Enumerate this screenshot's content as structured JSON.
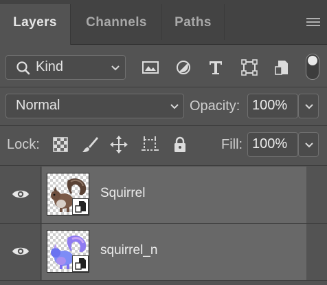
{
  "tabs": [
    {
      "label": "Layers",
      "active": true
    },
    {
      "label": "Channels",
      "active": false
    },
    {
      "label": "Paths",
      "active": false
    }
  ],
  "filter": {
    "kind_label": "Kind",
    "icons": [
      "image-filter-icon",
      "adjustment-filter-icon",
      "type-filter-icon",
      "shape-filter-icon",
      "smart-object-filter-icon"
    ],
    "toggle_on": true
  },
  "blend": {
    "mode": "Normal",
    "opacity_label": "Opacity:",
    "opacity_value": "100%"
  },
  "lock": {
    "label": "Lock:",
    "icons": [
      "lock-transparent-pixels-icon",
      "lock-image-pixels-icon",
      "lock-position-icon",
      "lock-artboard-icon",
      "lock-all-icon"
    ],
    "fill_label": "Fill:",
    "fill_value": "100%"
  },
  "layers": [
    {
      "name": "Squirrel",
      "visible": true,
      "thumbnail": "squirrel-photo"
    },
    {
      "name": "squirrel_n",
      "visible": true,
      "thumbnail": "squirrel-normal-map"
    }
  ],
  "colors": {
    "panel_bg": "#535353",
    "tabbar_bg": "#434343",
    "layer_row_bg": "#686868"
  }
}
